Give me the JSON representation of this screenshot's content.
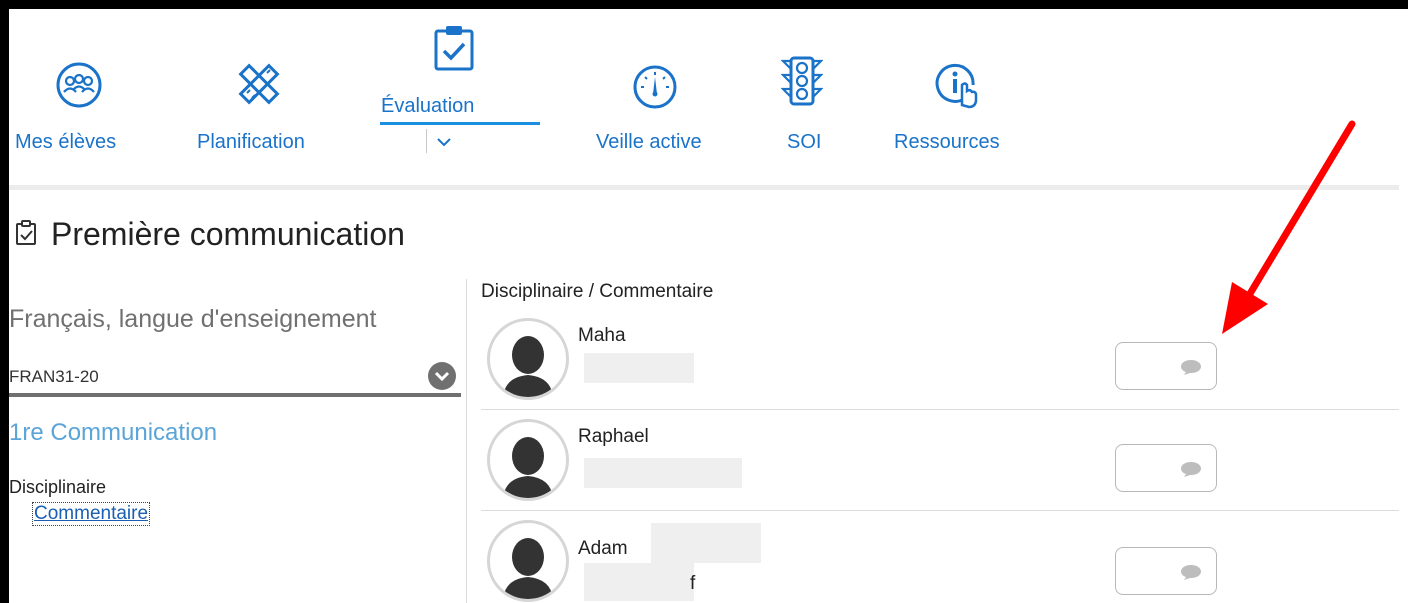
{
  "nav": {
    "items": [
      {
        "id": "mes-eleves",
        "label": "Mes élèves",
        "icon": "group-icon"
      },
      {
        "id": "planification",
        "label": "Planification",
        "icon": "ruler-pencil-icon"
      },
      {
        "id": "evaluation",
        "label": "Évaluation",
        "icon": "clipboard-check-icon",
        "active": true
      },
      {
        "id": "veille-active",
        "label": "Veille active",
        "icon": "gauge-icon"
      },
      {
        "id": "soi",
        "label": "SOI",
        "icon": "traffic-light-icon"
      },
      {
        "id": "ressources",
        "label": "Ressources",
        "icon": "info-touch-icon"
      }
    ],
    "accent_color": "#1a73c9"
  },
  "page": {
    "title": "Première communication"
  },
  "left_panel": {
    "course_name": "Français, langue d'enseignement",
    "course_code": "FRAN31-20",
    "communication_link": "1re Communication",
    "discipline_label": "Disciplinaire",
    "comment_link": "Commentaire"
  },
  "list": {
    "header": "Disciplinaire / Commentaire",
    "students": [
      {
        "first_name": "Maha",
        "extra": ""
      },
      {
        "first_name": "Raphael",
        "extra": ""
      },
      {
        "first_name": "Adam",
        "extra": "f"
      }
    ]
  },
  "annotation": {
    "arrow_color": "#ff0000"
  }
}
